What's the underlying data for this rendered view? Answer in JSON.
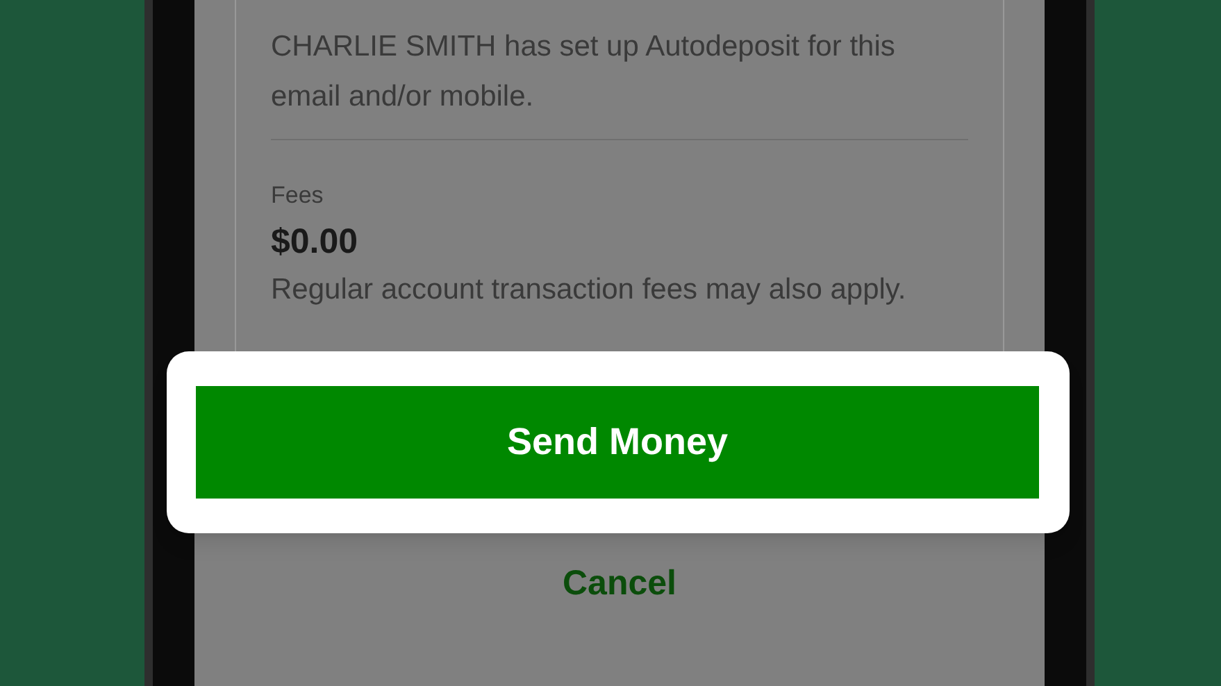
{
  "autodeposit": {
    "message": "CHARLIE SMITH has set up Autodeposit for this email and/or mobile."
  },
  "fees": {
    "label": "Fees",
    "amount": "$0.00",
    "note": "Regular account transaction fees may also apply."
  },
  "highlighted_button": {
    "label": "Send Money"
  },
  "cancel_button": {
    "label": "Cancel"
  }
}
